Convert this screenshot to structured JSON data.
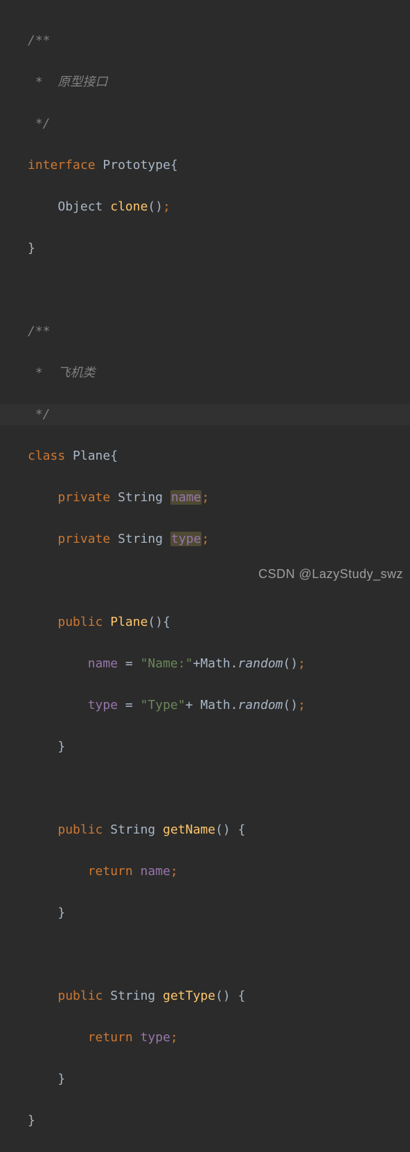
{
  "watermark": "CSDN @LazyStudy_swz",
  "code": {
    "c1_open": "/**",
    "c1_body": " *  原型接口",
    "c1_close": " */",
    "iface_kw": "interface",
    "iface_name": "Prototype",
    "obj_type": "Object",
    "clone_name": "clone",
    "c2_open": "/**",
    "c2_body": " *  飞机类",
    "c2_close": " */",
    "class_kw": "class",
    "class_name": "Plane",
    "private_kw": "private",
    "string_type": "String",
    "field_name": "name",
    "field_type": "type",
    "public_kw": "public",
    "ctor_name": "Plane",
    "assign_name": "name",
    "assign_type": "type",
    "assign_eq": " = ",
    "str_name": "\"Name:\"",
    "str_type": "\"Type\"",
    "plus1": "+",
    "plus2": "+ ",
    "math_cls": "Math",
    "random_m": "random",
    "getName_m": "getName",
    "getType_m": "getType",
    "return_kw": "return"
  }
}
